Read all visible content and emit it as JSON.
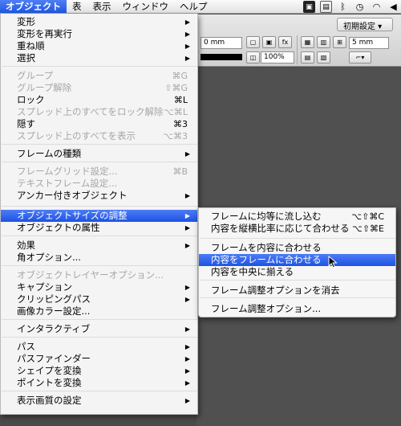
{
  "menubar": {
    "items": [
      "オブジェクト",
      "表",
      "表示",
      "ウィンドウ",
      "ヘルプ"
    ],
    "tray_icons": [
      "box-icon",
      "photo-icon",
      "bluetooth-icon",
      "clock-icon",
      "wifi-icon",
      "speaker-icon"
    ]
  },
  "toolbar": {
    "field1": "0 mm",
    "field2": "100%",
    "field3": "5 mm",
    "preset_label": "初期設定 ▾"
  },
  "menu": {
    "items": [
      {
        "label": "変形",
        "shortcut": "",
        "arrow": true,
        "disabled": false
      },
      {
        "label": "変形を再実行",
        "shortcut": "",
        "arrow": true,
        "disabled": false
      },
      {
        "label": "重ね順",
        "shortcut": "",
        "arrow": true,
        "disabled": false
      },
      {
        "label": "選択",
        "shortcut": "",
        "arrow": true,
        "disabled": false
      },
      {
        "label": "グループ",
        "shortcut": "⌘G",
        "arrow": false,
        "disabled": true
      },
      {
        "label": "グループ解除",
        "shortcut": "⇧⌘G",
        "arrow": false,
        "disabled": true
      },
      {
        "label": "ロック",
        "shortcut": "⌘L",
        "arrow": false,
        "disabled": false
      },
      {
        "label": "スプレッド上のすべてをロック解除",
        "shortcut": "⌥⌘L",
        "arrow": false,
        "disabled": true
      },
      {
        "label": "隠す",
        "shortcut": "⌘3",
        "arrow": false,
        "disabled": false
      },
      {
        "label": "スプレッド上のすべてを表示",
        "shortcut": "⌥⌘3",
        "arrow": false,
        "disabled": true
      },
      {
        "label": "フレームの種類",
        "shortcut": "",
        "arrow": true,
        "disabled": false
      },
      {
        "label": "フレームグリッド設定...",
        "shortcut": "⌘B",
        "arrow": false,
        "disabled": true
      },
      {
        "label": "テキストフレーム設定...",
        "shortcut": "",
        "arrow": false,
        "disabled": true
      },
      {
        "label": "アンカー付きオブジェクト",
        "shortcut": "",
        "arrow": true,
        "disabled": false
      },
      {
        "label": "オブジェクトサイズの調整",
        "shortcut": "",
        "arrow": true,
        "disabled": false
      },
      {
        "label": "オブジェクトの属性",
        "shortcut": "",
        "arrow": true,
        "disabled": false
      },
      {
        "label": "効果",
        "shortcut": "",
        "arrow": true,
        "disabled": false
      },
      {
        "label": "角オプション...",
        "shortcut": "",
        "arrow": false,
        "disabled": false
      },
      {
        "label": "オブジェクトレイヤーオプション...",
        "shortcut": "",
        "arrow": false,
        "disabled": true
      },
      {
        "label": "キャプション",
        "shortcut": "",
        "arrow": true,
        "disabled": false
      },
      {
        "label": "クリッピングパス",
        "shortcut": "",
        "arrow": true,
        "disabled": false
      },
      {
        "label": "画像カラー設定...",
        "shortcut": "",
        "arrow": false,
        "disabled": false
      },
      {
        "label": "インタラクティブ",
        "shortcut": "",
        "arrow": true,
        "disabled": false
      },
      {
        "label": "パス",
        "shortcut": "",
        "arrow": true,
        "disabled": false
      },
      {
        "label": "パスファインダー",
        "shortcut": "",
        "arrow": true,
        "disabled": false
      },
      {
        "label": "シェイプを変換",
        "shortcut": "",
        "arrow": true,
        "disabled": false
      },
      {
        "label": "ポイントを変換",
        "shortcut": "",
        "arrow": true,
        "disabled": false
      },
      {
        "label": "表示画質の設定",
        "shortcut": "",
        "arrow": true,
        "disabled": false
      }
    ]
  },
  "submenu": {
    "items": [
      {
        "label": "フレームに均等に流し込む",
        "shortcut": "⌥⇧⌘C"
      },
      {
        "label": "内容を縦横比率に応じて合わせる",
        "shortcut": "⌥⇧⌘E"
      },
      {
        "label": "フレームを内容に合わせる",
        "shortcut": ""
      },
      {
        "label": "内容をフレームに合わせる",
        "shortcut": ""
      },
      {
        "label": "内容を中央に揃える",
        "shortcut": ""
      },
      {
        "label": "フレーム調整オプションを消去",
        "shortcut": ""
      },
      {
        "label": "フレーム調整オプション...",
        "shortcut": ""
      }
    ]
  }
}
